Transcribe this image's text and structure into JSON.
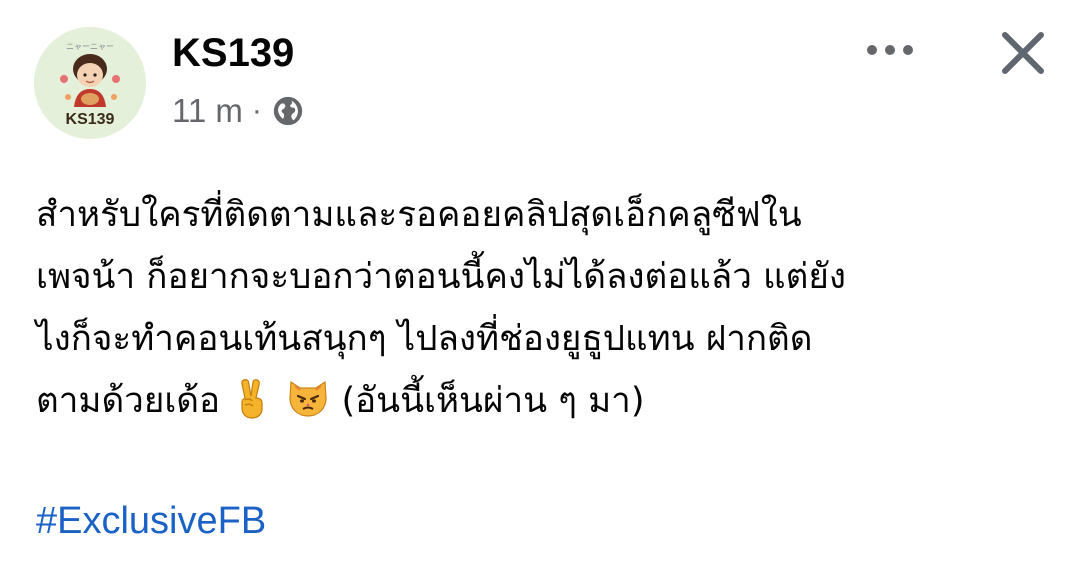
{
  "post": {
    "author": {
      "name": "KS139",
      "avatar_text": "KS139",
      "avatar_caption": "ニャーニャー"
    },
    "meta": {
      "time": "11 m",
      "separator": "·",
      "privacy_icon": "globe-icon"
    },
    "actions": {
      "more_icon": "more-horizontal-icon",
      "close_icon": "close-icon"
    },
    "text_lines": [
      "สำหรับใครที่ติดตามและรอคอยคลิปสุดเอ็กคลูซีฟใน",
      "เพจน้า ก็อยากจะบอกว่าตอนนี้คงไม่ได้ลงต่อแล้ว  แต่ยัง",
      "ไงก็จะทำคอนเท้นสนุกๆ ไปลงที่ช่องยูธูปแทน ฝากติด"
    ],
    "last_line": {
      "before_emoji": "ตามด้วยเด้อ ",
      "emojis": [
        "victory-hand-icon",
        "pouting-cat-icon"
      ],
      "after_emoji": " (อันนี้เห็นผ่าน ๆ มา)"
    },
    "hashtag": "#ExclusiveFB",
    "colors": {
      "text": "#050505",
      "meta": "#65676b",
      "hashtag": "#1a62c6",
      "avatar_bg": "#e4f0d9",
      "icon": "#65676b"
    }
  }
}
